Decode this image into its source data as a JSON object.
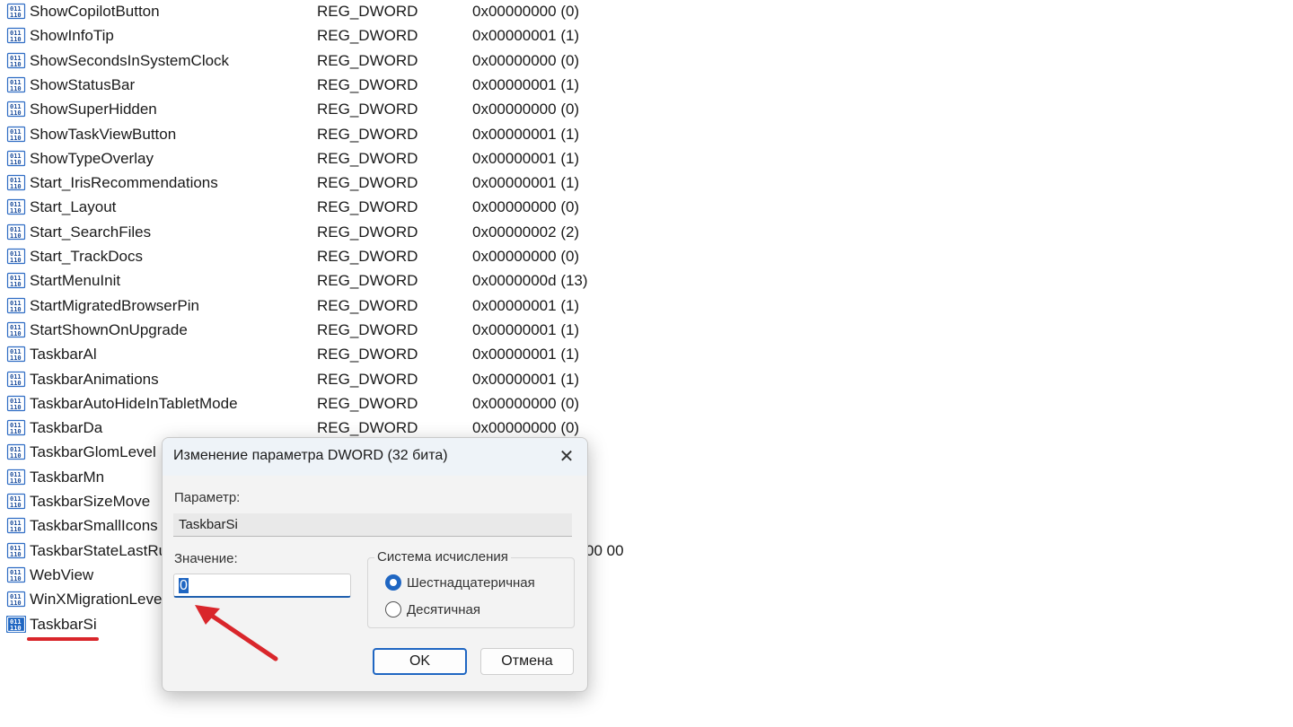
{
  "registry": {
    "rows": [
      {
        "name": "ShowCopilotButton",
        "type": "REG_DWORD",
        "data": "0x00000000 (0)"
      },
      {
        "name": "ShowInfoTip",
        "type": "REG_DWORD",
        "data": "0x00000001 (1)"
      },
      {
        "name": "ShowSecondsInSystemClock",
        "type": "REG_DWORD",
        "data": "0x00000000 (0)"
      },
      {
        "name": "ShowStatusBar",
        "type": "REG_DWORD",
        "data": "0x00000001 (1)"
      },
      {
        "name": "ShowSuperHidden",
        "type": "REG_DWORD",
        "data": "0x00000000 (0)"
      },
      {
        "name": "ShowTaskViewButton",
        "type": "REG_DWORD",
        "data": "0x00000001 (1)"
      },
      {
        "name": "ShowTypeOverlay",
        "type": "REG_DWORD",
        "data": "0x00000001 (1)"
      },
      {
        "name": "Start_IrisRecommendations",
        "type": "REG_DWORD",
        "data": "0x00000001 (1)"
      },
      {
        "name": "Start_Layout",
        "type": "REG_DWORD",
        "data": "0x00000000 (0)"
      },
      {
        "name": "Start_SearchFiles",
        "type": "REG_DWORD",
        "data": "0x00000002 (2)"
      },
      {
        "name": "Start_TrackDocs",
        "type": "REG_DWORD",
        "data": "0x00000000 (0)"
      },
      {
        "name": "StartMenuInit",
        "type": "REG_DWORD",
        "data": "0x0000000d (13)"
      },
      {
        "name": "StartMigratedBrowserPin",
        "type": "REG_DWORD",
        "data": "0x00000001 (1)"
      },
      {
        "name": "StartShownOnUpgrade",
        "type": "REG_DWORD",
        "data": "0x00000001 (1)"
      },
      {
        "name": "TaskbarAl",
        "type": "REG_DWORD",
        "data": "0x00000001 (1)"
      },
      {
        "name": "TaskbarAnimations",
        "type": "REG_DWORD",
        "data": "0x00000001 (1)"
      },
      {
        "name": "TaskbarAutoHideInTabletMode",
        "type": "REG_DWORD",
        "data": "0x00000000 (0)"
      },
      {
        "name": "TaskbarDa",
        "type": "REG_DWORD",
        "data": "0x00000000 (0)"
      },
      {
        "name": "TaskbarGlomLevel",
        "type": "",
        "data": ""
      },
      {
        "name": "TaskbarMn",
        "type": "",
        "data": ""
      },
      {
        "name": "TaskbarSizeMove",
        "type": "",
        "data": ""
      },
      {
        "name": "TaskbarSmallIcons",
        "type": "",
        "data": ""
      },
      {
        "name": "TaskbarStateLastRun",
        "type": "",
        "data": "00 00"
      },
      {
        "name": "WebView",
        "type": "",
        "data": ""
      },
      {
        "name": "WinXMigrationLevel",
        "type": "",
        "data": ""
      },
      {
        "name": "TaskbarSi",
        "type": "",
        "data": "",
        "selected": true
      }
    ],
    "icon": "registry-binary-value-icon"
  },
  "dialog": {
    "title": "Изменение параметра DWORD (32 бита)",
    "close_icon": "close-icon",
    "param_label": "Параметр:",
    "param_value": "TaskbarSi",
    "value_label": "Значение:",
    "value_input": "0",
    "radix_group_label": "Система исчисления",
    "radix_hex_label": "Шестнадцатеричная",
    "radix_dec_label": "Десятичная",
    "radix_selected": "hex",
    "ok_label": "OK",
    "cancel_label": "Отмена"
  },
  "annotations": {
    "arrow_color": "#d9262b",
    "underline_color": "#d9262b"
  }
}
